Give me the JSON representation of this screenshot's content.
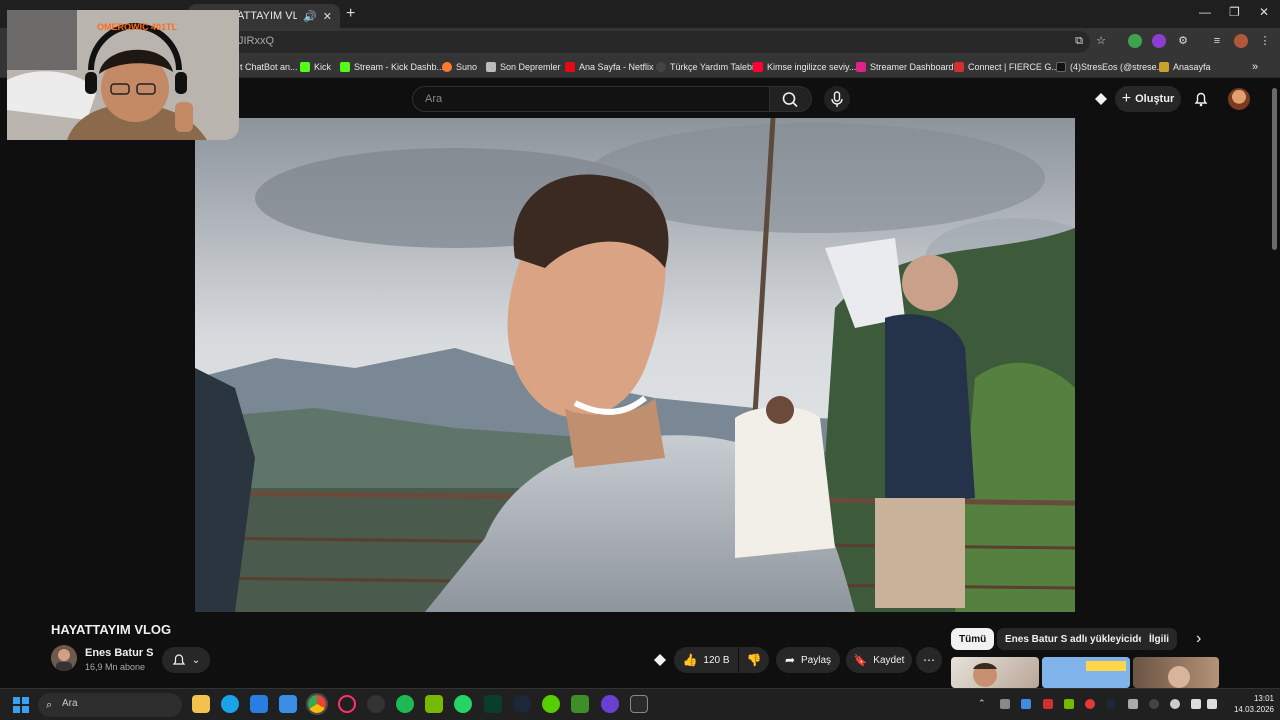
{
  "browser": {
    "tab_title": "HAYATTAYIM VLOG - YouTube",
    "url": "JIRxxQ",
    "bookmarks": [
      "t ChatBot an...",
      "Kick",
      "Stream - Kick Dashb...",
      "Suno",
      "Son Depremler",
      "Ana Sayfa - Netflix",
      "Türkçe Yardım Talebi",
      "Kimse ingilizce seviy...",
      "Streamer Dashboard",
      "Connect | FIERCE G...",
      "(4)StresEos (@strese...",
      "Anasayfa"
    ]
  },
  "youtube": {
    "search_placeholder": "Ara",
    "create_label": "Oluştur",
    "video_title": "HAYATTAYIM VLOG",
    "channel_name": "Enes Batur S",
    "subscribers": "16,9 Mn abone",
    "like_count": "120 B",
    "share_label": "Paylaş",
    "save_label": "Kaydet",
    "chips": [
      "Tümü",
      "Enes Batur S adlı yükleyiciden",
      "İlgili"
    ]
  },
  "webcam_overlay": {
    "label": "OMEROWIC 401TL"
  },
  "taskbar": {
    "search_placeholder": "Ara",
    "time": "13:01",
    "date": "14.03.2026"
  },
  "colors": {
    "youtube_red": "#ff0033",
    "background": "#0f0f0f",
    "overlay_orange": "#ff6a1a"
  }
}
